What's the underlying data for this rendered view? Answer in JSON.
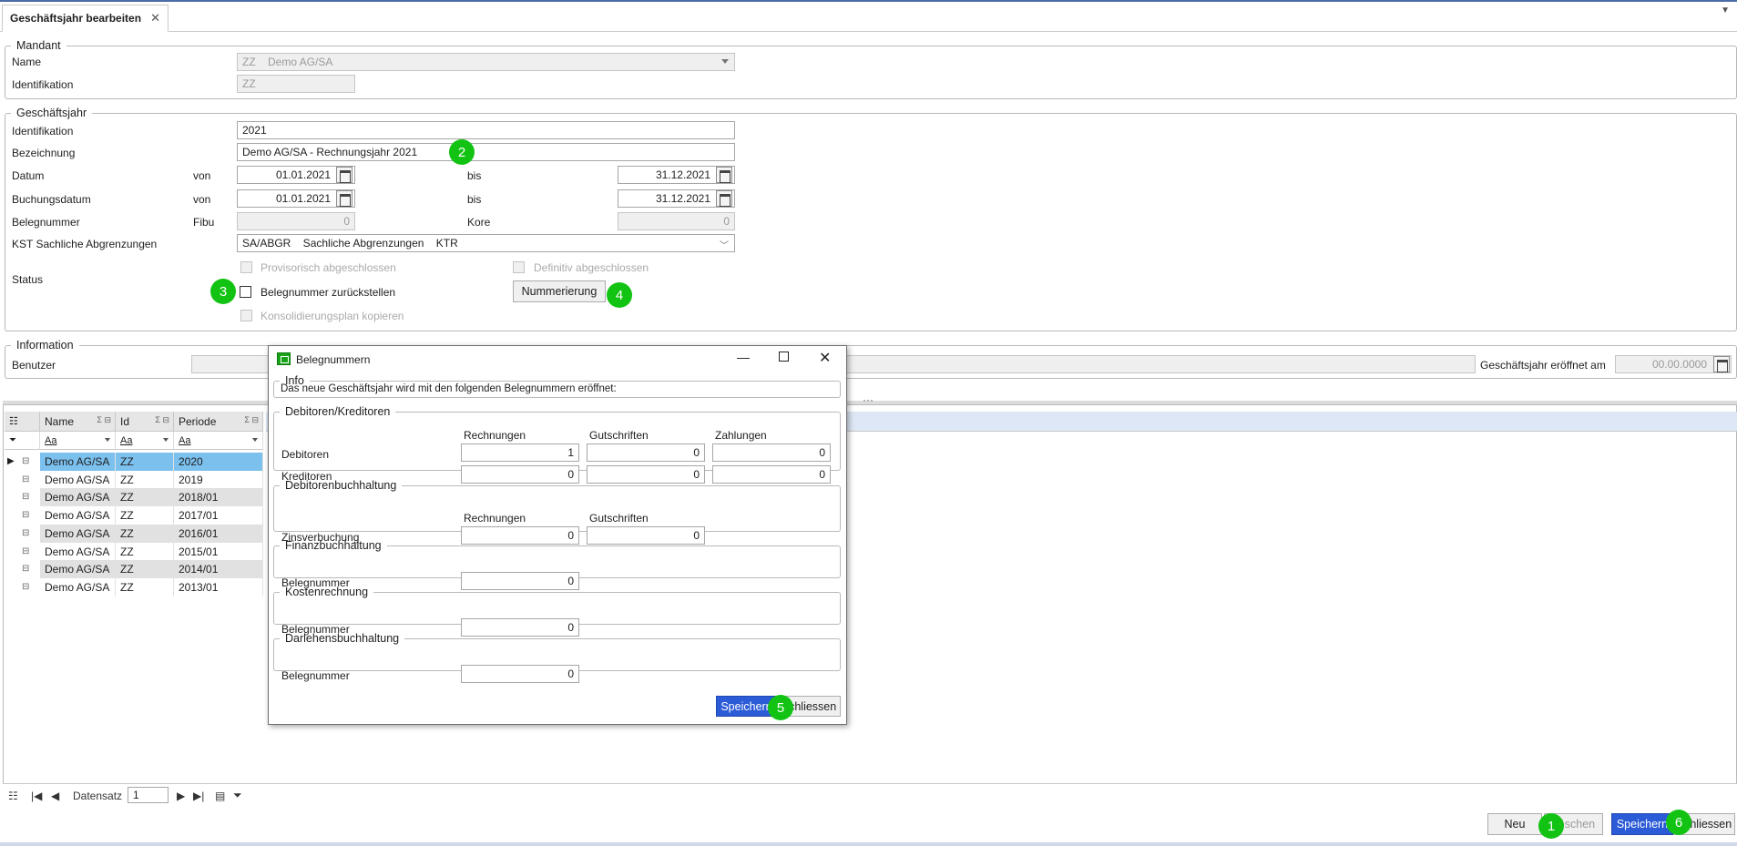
{
  "tab": {
    "title": "Geschäftsjahr bearbeiten",
    "close": "✕"
  },
  "mandant": {
    "legend": "Mandant",
    "name_label": "Name",
    "name_value": "ZZ    Demo AG/SA",
    "ident_label": "Identifikation",
    "ident_value": "ZZ"
  },
  "gj": {
    "legend": "Geschäftsjahr",
    "ident_label": "Identifikation",
    "ident_value": "2021",
    "bez_label": "Bezeichnung",
    "bez_value": "Demo AG/SA - Rechnungsjahr 2021",
    "datum_label": "Datum",
    "von": "von",
    "bis": "bis",
    "datum_von": "01.01.2021",
    "datum_bis": "31.12.2021",
    "buch_label": "Buchungsdatum",
    "buch_von": "01.01.2021",
    "buch_bis": "31.12.2021",
    "beleg_label": "Belegnummer",
    "fibu": "Fibu",
    "fibu_value": "0",
    "kore": "Kore",
    "kore_value": "0",
    "kst_label": "KST Sachliche Abgrenzungen",
    "kst_value": "SA/ABGR    Sachliche Abgrenzungen    KTR",
    "status_label": "Status",
    "prov": "Provisorisch abgeschlossen",
    "def": "Definitiv abgeschlossen",
    "zurueck": "Belegnummer zurückstellen",
    "nummerierung": "Nummerierung",
    "konsol": "Konsolidierungsplan kopieren"
  },
  "info": {
    "legend": "Information",
    "benutzer_label": "Benutzer",
    "eroeffnet_label": "Geschäftsjahr eröffnet am",
    "eroeffnet_value": "00.00.0000"
  },
  "grid": {
    "columns": [
      "Name",
      "Id",
      "Periode"
    ],
    "filter": "Aa",
    "rows": [
      [
        "Demo AG/SA",
        "ZZ",
        "2020"
      ],
      [
        "Demo AG/SA",
        "ZZ",
        "2019"
      ],
      [
        "Demo AG/SA",
        "ZZ",
        "2018/01"
      ],
      [
        "Demo AG/SA",
        "ZZ",
        "2017/01"
      ],
      [
        "Demo AG/SA",
        "ZZ",
        "2016/01"
      ],
      [
        "Demo AG/SA",
        "ZZ",
        "2015/01"
      ],
      [
        "Demo AG/SA",
        "ZZ",
        "2014/01"
      ],
      [
        "Demo AG/SA",
        "ZZ",
        "2013/01"
      ]
    ],
    "splitter_dots": "···"
  },
  "navbar": {
    "datensatz_label": "Datensatz",
    "datensatz_value": "1"
  },
  "footer": {
    "neu": "Neu",
    "loeschen": "Löschen",
    "speichern": "Speichern",
    "schliessen": "Schliessen"
  },
  "dialog": {
    "title": "Belegnummern",
    "info_legend": "Info",
    "info_text": "Das neue Geschäftsjahr wird mit den folgenden Belegnummern eröffnet:",
    "dk_legend": "Debitoren/Kreditoren",
    "col_rechnungen": "Rechnungen",
    "col_gutschriften": "Gutschriften",
    "col_zahlungen": "Zahlungen",
    "debitoren": "Debitoren",
    "kreditoren": "Kreditoren",
    "deb_r": "1",
    "deb_g": "0",
    "deb_z": "0",
    "kred_r": "0",
    "kred_g": "0",
    "kred_z": "0",
    "debbuch_legend": "Debitorenbuchhaltung",
    "zins_label": "Zinsverbuchung",
    "zins_r": "0",
    "zins_g": "0",
    "fibu_legend": "Finanzbuchhaltung",
    "belegnummer": "Belegnummer",
    "fibu_value": "0",
    "kore_legend": "Kostenrechnung",
    "kore_value": "0",
    "darl_legend": "Darlehensbuchhaltung",
    "darl_value": "0",
    "speichern": "Speichern",
    "schliessen": "Schliessen"
  },
  "badges": [
    "1",
    "2",
    "3",
    "4",
    "5",
    "6"
  ],
  "colors": {
    "accent": "#2b5bd6",
    "badge": "#13c313",
    "selection": "#7cc0ee"
  }
}
